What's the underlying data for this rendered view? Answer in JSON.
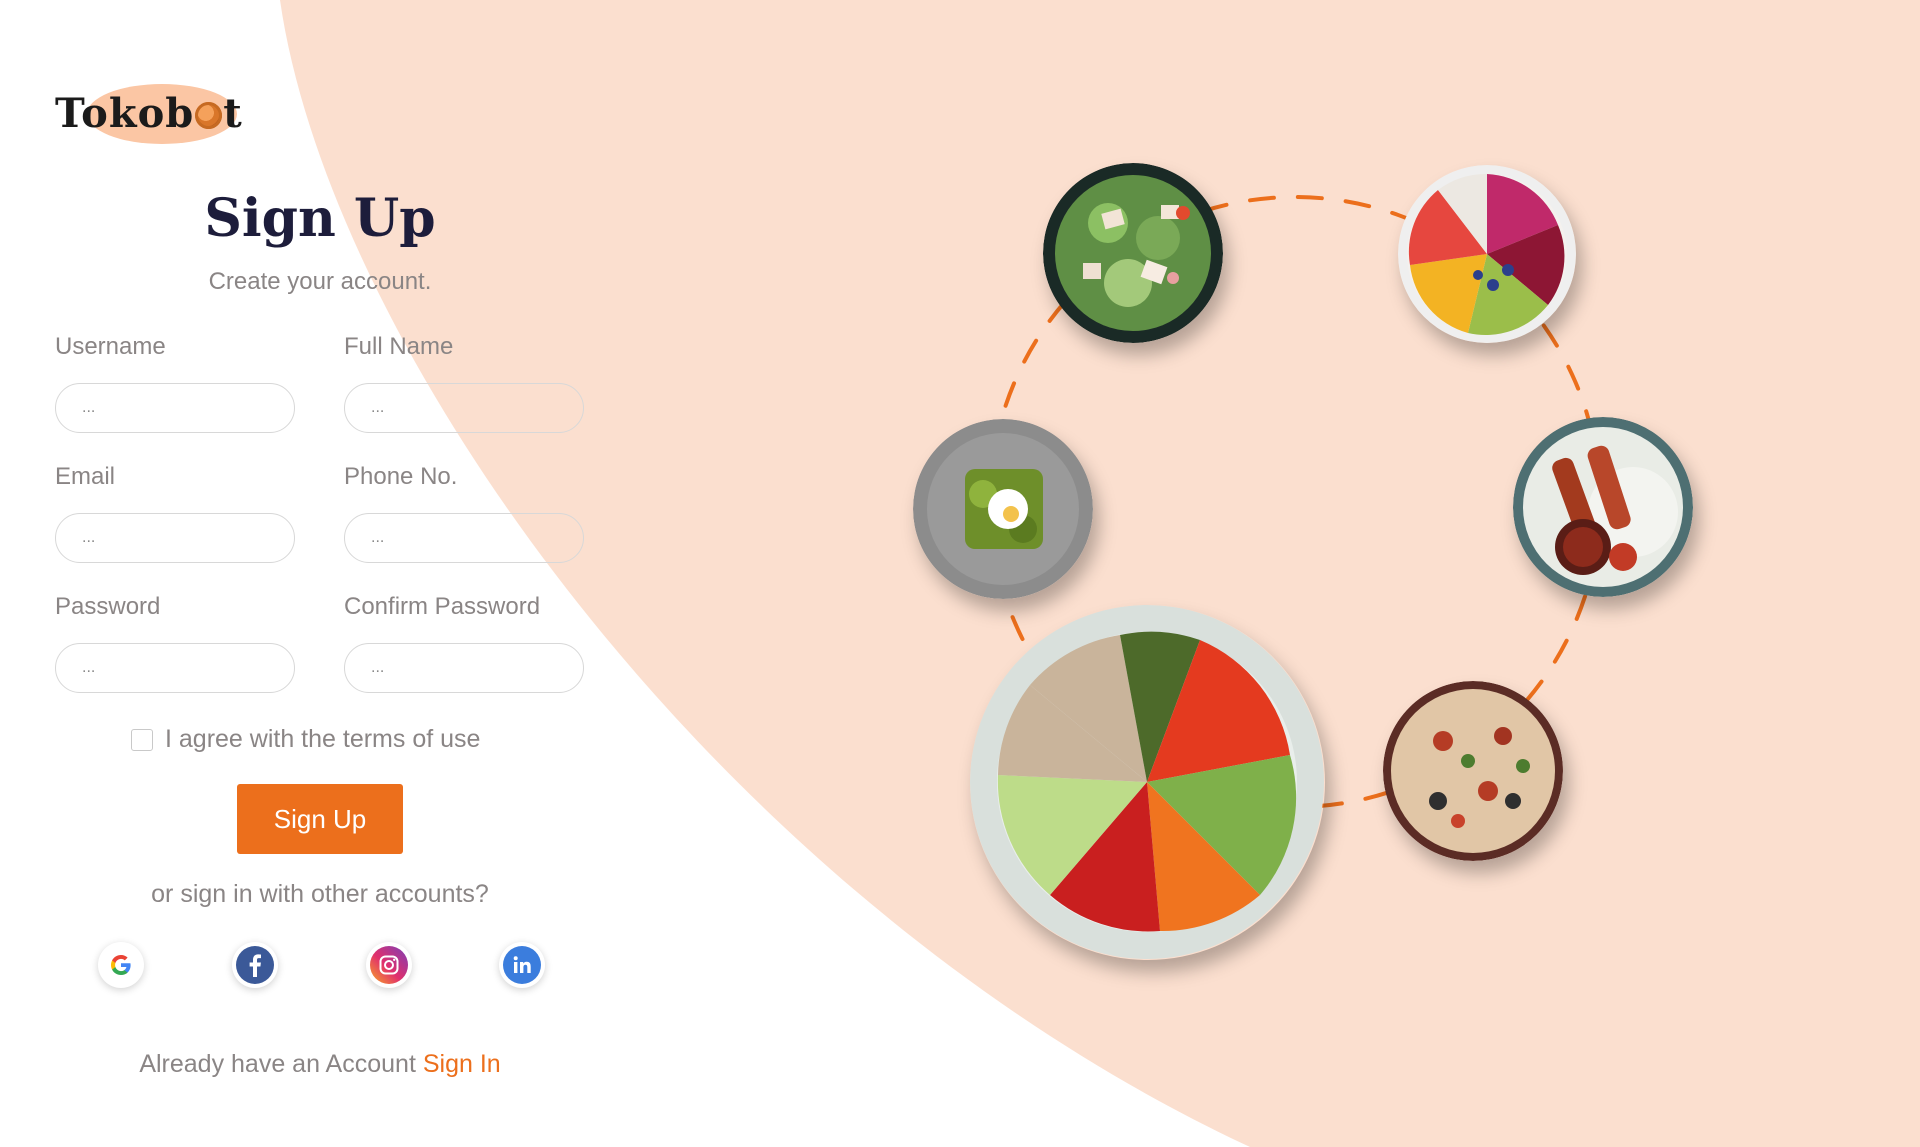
{
  "brand": {
    "name_prefix": "Tokob",
    "name_suffix": "t",
    "colors": {
      "accent": "#ec6f1c",
      "peach": "#fbdfcf",
      "logo_blob": "#fbc6a4",
      "title": "#1d1d3b",
      "muted": "#8a8585"
    }
  },
  "form": {
    "title": "Sign Up",
    "subtitle": "Create your account.",
    "fields": {
      "username": {
        "label": "Username",
        "placeholder": "..."
      },
      "full_name": {
        "label": "Full Name",
        "placeholder": "..."
      },
      "email": {
        "label": "Email",
        "placeholder": "..."
      },
      "phone": {
        "label": "Phone No.",
        "placeholder": "..."
      },
      "password": {
        "label": "Password",
        "placeholder": "..."
      },
      "confirm_password": {
        "label": "Confirm Password",
        "placeholder": "..."
      }
    },
    "terms_label": "I agree with the terms of use",
    "submit_label": "Sign Up",
    "alt_signin_text": "or sign in with other accounts?",
    "social": [
      {
        "name": "google",
        "icon": "google-icon"
      },
      {
        "name": "facebook",
        "icon": "facebook-icon"
      },
      {
        "name": "instagram",
        "icon": "instagram-icon"
      },
      {
        "name": "linkedin",
        "icon": "linkedin-icon"
      }
    ],
    "footer_text": "Already have an Account",
    "signin_label": "Sign In"
  },
  "illustration": {
    "plates": [
      "salad-bowl",
      "smoothie-bowl",
      "avocado-toast",
      "kebab-plate",
      "grain-bowl",
      "pizza"
    ]
  }
}
